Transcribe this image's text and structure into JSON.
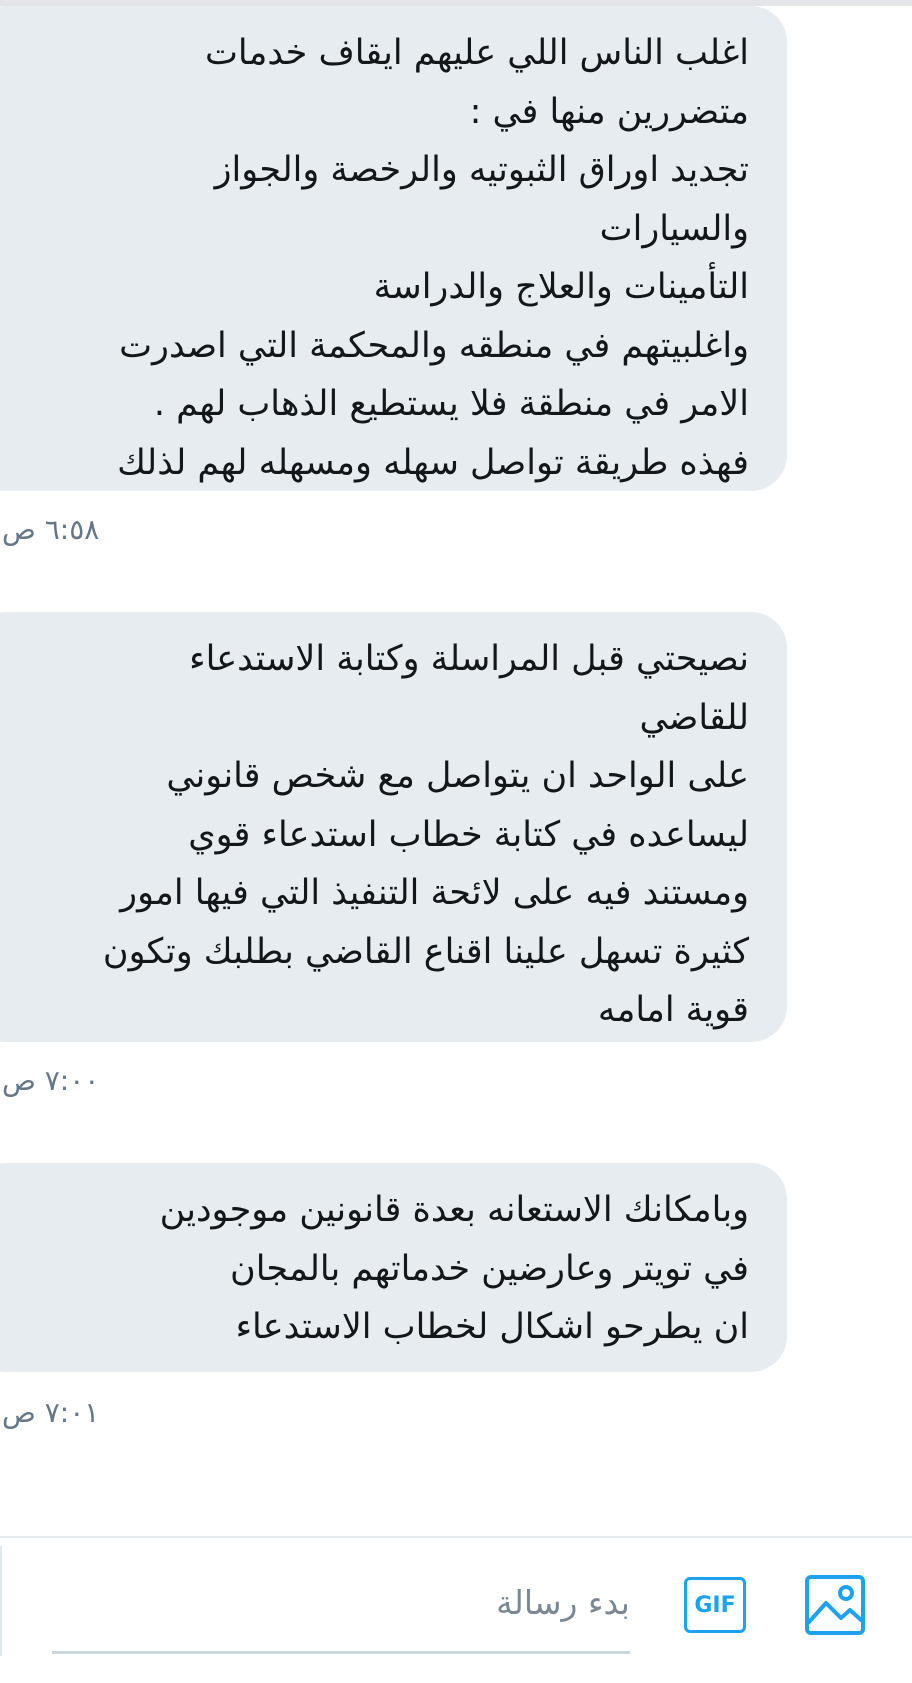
{
  "messages": [
    {
      "lines": [
        "اغلب الناس اللي عليهم ايقاف خدمات",
        "متضررين منها في :",
        "تجديد اوراق الثبوتيه والرخصة والجواز",
        "والسيارات",
        "التأمينات والعلاج والدراسة",
        "واغلبيتهم في منطقه والمحكمة التي اصدرت",
        "الامر في منطقة فلا يستطيع الذهاب لهم .",
        "فهذه طريقة تواصل سهله ومسهله لهم لذلك"
      ],
      "time": "٦:٥٨ ص"
    },
    {
      "lines": [
        "نصيحتي قبل المراسلة وكتابة الاستدعاء",
        "للقاضي",
        "على الواحد ان يتواصل مع شخص قانوني",
        "ليساعده في كتابة خطاب استدعاء قوي",
        "ومستند فيه على لائحة التنفيذ التي فيها امور",
        "كثيرة تسهل علينا اقناع القاضي بطلبك وتكون",
        "قوية امامه"
      ],
      "time": "٧:٠٠ ص"
    },
    {
      "lines": [
        "وبامكانك الاستعانه بعدة قانونين موجودين",
        "في تويتر وعارضين خدماتهم بالمجان",
        "ان يطرحو اشكال لخطاب الاستدعاء"
      ],
      "time": "٧:٠١ ص"
    }
  ],
  "composer": {
    "placeholder": "بدء رسالة",
    "value": "",
    "gif_label": "GIF",
    "gif_icon": "gif-icon",
    "image_icon": "image-icon"
  },
  "colors": {
    "bubble_bg": "#e6ecf0",
    "text": "#14171a",
    "timestamp": "#657786",
    "accent": "#1da1f2"
  }
}
